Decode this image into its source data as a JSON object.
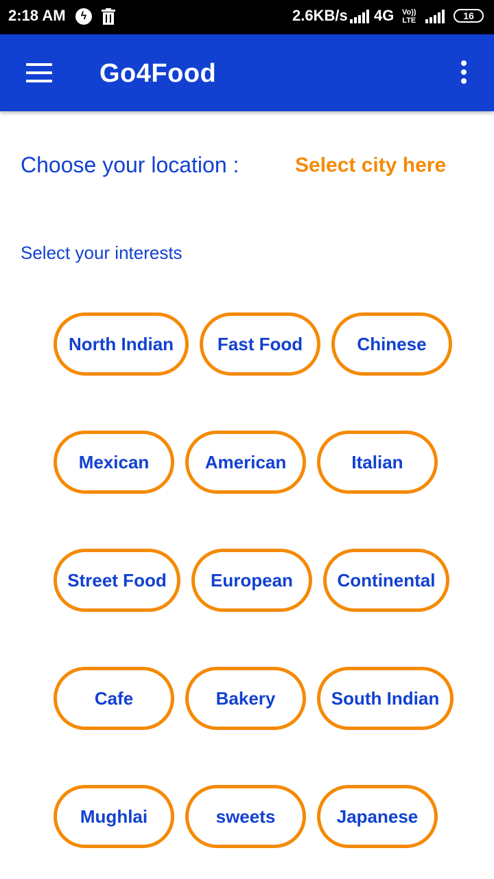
{
  "status_bar": {
    "time": "2:18 AM",
    "speed": "2.6KB/s",
    "network": "4G",
    "volte": "Vo)) LTE",
    "battery": "16",
    "icons": [
      "bolt-icon",
      "trash-icon",
      "signal-icon",
      "signal-icon",
      "battery-icon"
    ]
  },
  "app_bar": {
    "title": "Go4Food",
    "menu_icon": "hamburger-menu-icon",
    "more_icon": "more-vert-icon"
  },
  "location": {
    "label": "Choose your location :",
    "select_text": "Select city here",
    "accent_color": "#f58a07"
  },
  "interests": {
    "label": "Select your interests",
    "chips": [
      [
        "North Indian",
        "Fast Food",
        "Chinese"
      ],
      [
        "Mexican",
        "American",
        "Italian"
      ],
      [
        "Street Food",
        "European",
        "Continental"
      ],
      [
        "Cafe",
        "Bakery",
        "South Indian"
      ],
      [
        "Mughlai",
        "sweets",
        "Japanese"
      ]
    ]
  },
  "colors": {
    "primary": "#1241d1",
    "accent": "#f58a07",
    "status_bar": "#000000"
  }
}
